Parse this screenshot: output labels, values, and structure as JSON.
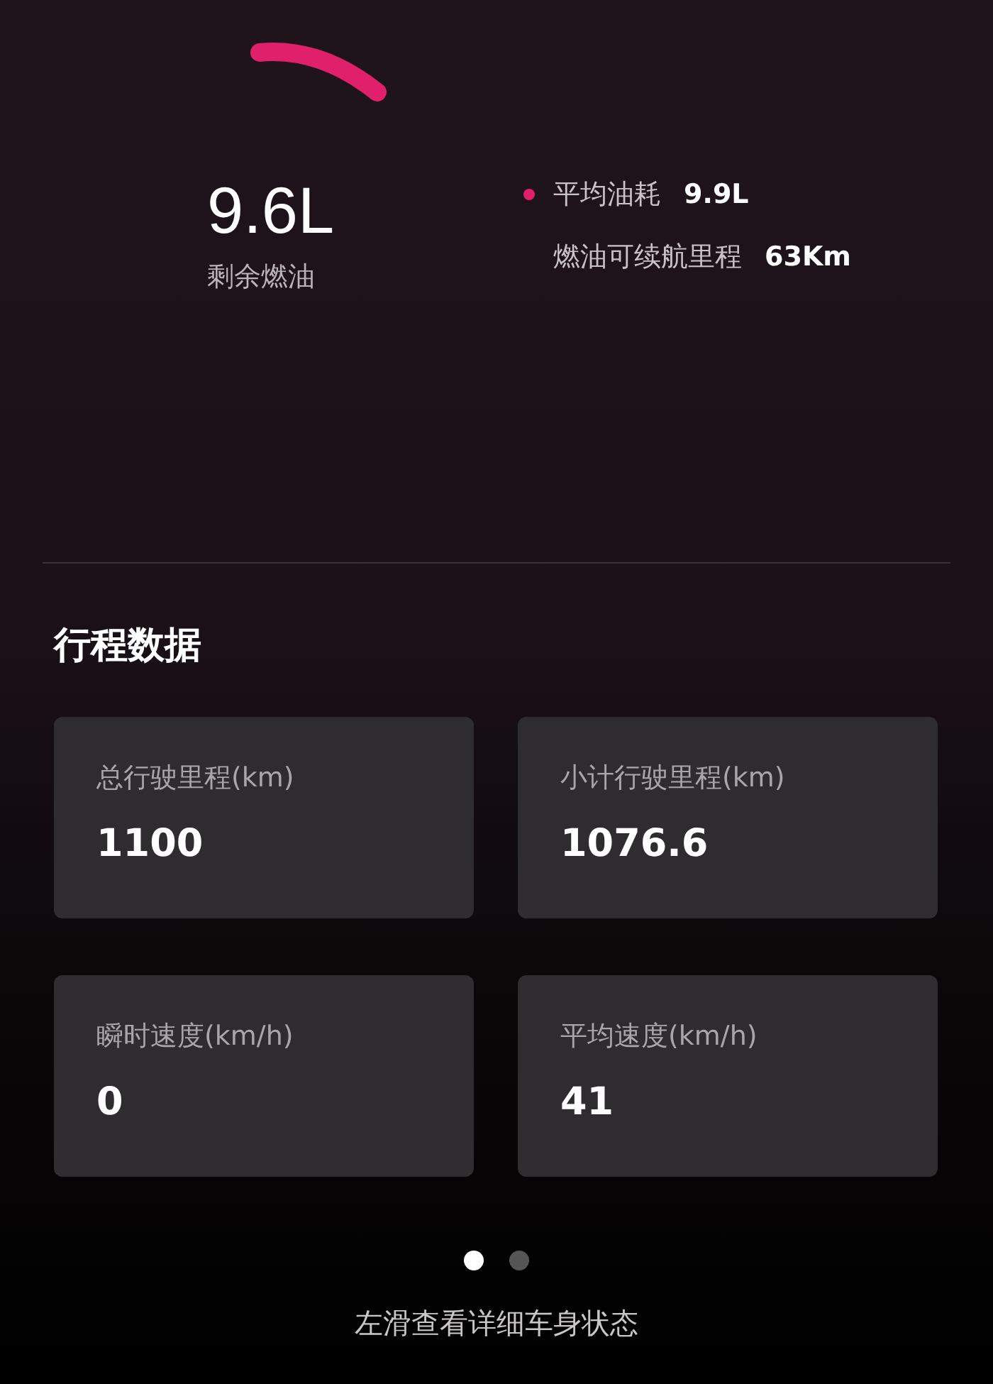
{
  "fuel": {
    "remaining": "9.6L",
    "remaining_label": "剩余燃油"
  },
  "fuel_stats": [
    {
      "label": "平均油耗",
      "value": "9.9L",
      "dot": true
    },
    {
      "label": "燃油可续航里程",
      "value": "63Km",
      "dot": false
    }
  ],
  "trip": {
    "title": "行程数据",
    "cards": [
      {
        "label": "总行驶里程(km)",
        "value": "1100"
      },
      {
        "label": "小计行驶里程(km)",
        "value": "1076.6"
      },
      {
        "label": "瞬时速度(km/h)",
        "value": "0"
      },
      {
        "label": "平均速度(km/h)",
        "value": "41"
      }
    ]
  },
  "pages": [
    {
      "selected": true
    },
    {
      "selected": false
    }
  ],
  "hint": "左滑查看详细车身状态"
}
